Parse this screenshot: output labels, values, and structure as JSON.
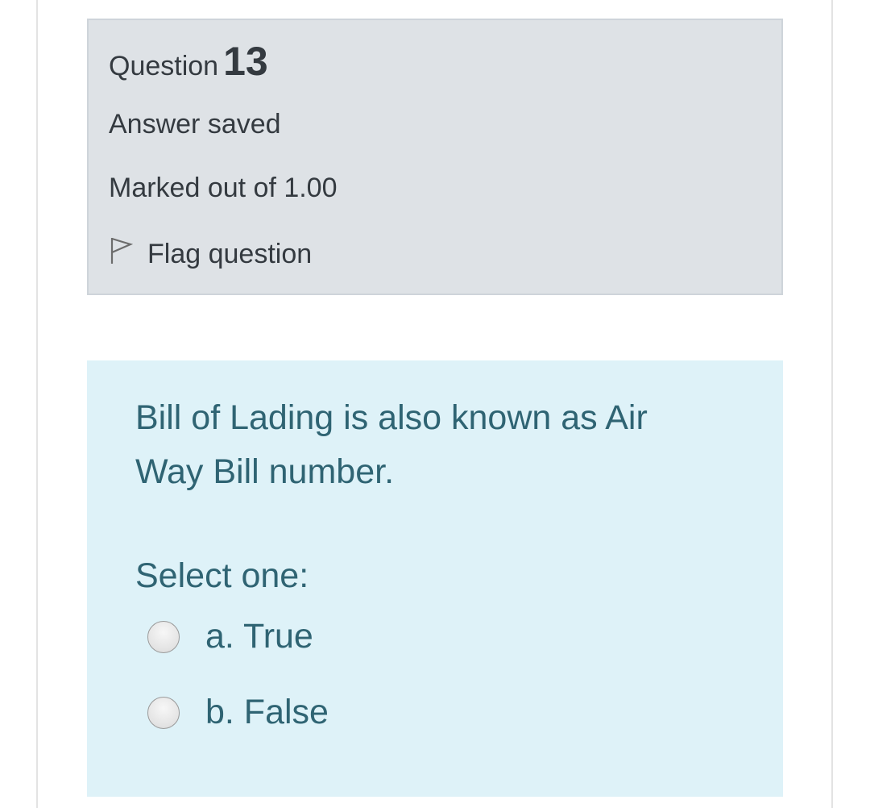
{
  "info": {
    "question_word": "Question",
    "question_number": "13",
    "state": "Answer saved",
    "grade": "Marked out of 1.00",
    "flag_label": "Flag question",
    "flag_icon": "flag-outline-icon"
  },
  "question": {
    "text": "Bill of Lading is also known as Air Way Bill number.",
    "prompt": "Select one:",
    "options": [
      {
        "label": "a. True",
        "selected": false
      },
      {
        "label": "b. False",
        "selected": false
      }
    ]
  },
  "colors": {
    "info_bg": "#dee2e6",
    "info_text": "#343a40",
    "question_bg": "#def2f8",
    "question_text": "#2f6473"
  }
}
